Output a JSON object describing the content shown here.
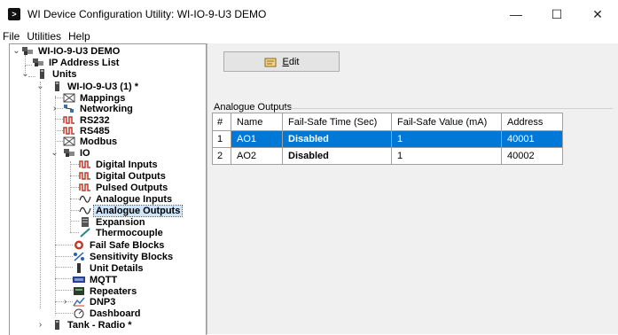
{
  "window": {
    "title": "WI Device Configuration Utility: WI-IO-9-U3 DEMO",
    "icon": "app-icon",
    "controls": {
      "minimize": "—",
      "maximize": "☐",
      "close": "✕"
    }
  },
  "menu": {
    "items": [
      "File",
      "Utilities",
      "Help"
    ]
  },
  "tree": {
    "nodes": [
      {
        "label": "WI-IO-9-U3 DEMO",
        "icon": "device-icon"
      },
      {
        "label": "IP Address List",
        "icon": "device-icon"
      },
      {
        "label": "Units",
        "icon": "unit-icon"
      },
      {
        "label": "WI-IO-9-U3 (1) *",
        "icon": "unit-icon"
      },
      {
        "label": "Mappings",
        "icon": "mappings-icon"
      },
      {
        "label": "Networking",
        "icon": "network-icon"
      },
      {
        "label": "RS232",
        "icon": "serial-icon"
      },
      {
        "label": "RS485",
        "icon": "serial-icon"
      },
      {
        "label": "Modbus",
        "icon": "mappings-icon"
      },
      {
        "label": "IO",
        "icon": "device-icon"
      },
      {
        "label": "Digital Inputs",
        "icon": "digital-io-icon"
      },
      {
        "label": "Digital Outputs",
        "icon": "digital-io-icon"
      },
      {
        "label": "Pulsed Outputs",
        "icon": "digital-io-icon"
      },
      {
        "label": "Analogue Inputs",
        "icon": "analogue-icon"
      },
      {
        "label": "Analogue Outputs",
        "icon": "analogue-icon"
      },
      {
        "label": "Expansion",
        "icon": "expansion-icon"
      },
      {
        "label": "Thermocouple",
        "icon": "thermocouple-icon"
      },
      {
        "label": "Fail Safe Blocks",
        "icon": "fail-safe-icon"
      },
      {
        "label": "Sensitivity Blocks",
        "icon": "sensitivity-icon"
      },
      {
        "label": "Unit Details",
        "icon": "unit-icon"
      },
      {
        "label": "MQTT",
        "icon": "mqtt-icon"
      },
      {
        "label": "Repeaters",
        "icon": "repeater-icon"
      },
      {
        "label": "DNP3",
        "icon": "dnp3-icon"
      },
      {
        "label": "Dashboard",
        "icon": "dashboard-icon"
      },
      {
        "label": "Tank - Radio *",
        "icon": "unit-icon"
      }
    ],
    "expanders": {
      "expanded": "⌄",
      "collapsed": "›"
    }
  },
  "toolbar": {
    "edit_label": "dit",
    "edit_mnemonic": "E"
  },
  "analogue_outputs": {
    "title": "Analogue Outputs",
    "columns": [
      "#",
      "Name",
      "Fail-Safe Time (Sec)",
      "Fail-Safe Value (mA)",
      "Address"
    ],
    "rows": [
      {
        "num": "1",
        "name": "AO1",
        "time": "Disabled",
        "value": "1",
        "address": "40001"
      },
      {
        "num": "2",
        "name": "AO2",
        "time": "Disabled",
        "value": "1",
        "address": "40002"
      }
    ]
  },
  "colors": {
    "selection": "#0078d7",
    "tree_selection": "#cde6fb",
    "panel_bg": "#f0f0f0"
  }
}
